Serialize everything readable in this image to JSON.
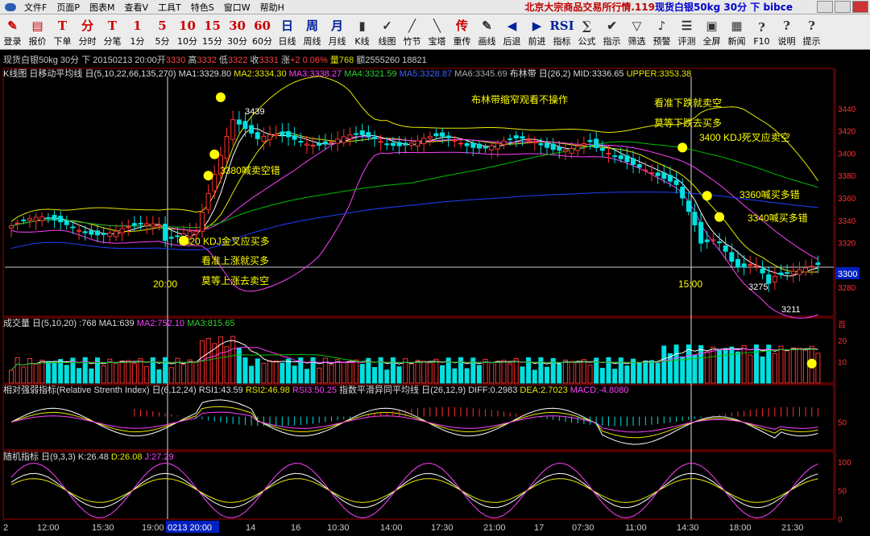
{
  "menubar": {
    "items": [
      "文件F",
      "页面P",
      "图表M",
      "查看V",
      "工具T",
      "特色S",
      "窗口W",
      "帮助H"
    ],
    "title_part1": "北京大宗商品交易所行情.119",
    "title_part2": "现货白银50kg 30分 下 bibce"
  },
  "toolbar": {
    "buttons": [
      {
        "icon": "✎",
        "label": "登录"
      },
      {
        "icon": "▤",
        "label": "报价"
      },
      {
        "icon": "T",
        "label": "下单"
      },
      {
        "icon": "分",
        "label": "分时"
      },
      {
        "icon": "T",
        "label": "分笔"
      },
      {
        "icon": "1",
        "label": "1分"
      },
      {
        "icon": "5",
        "label": "5分"
      },
      {
        "icon": "10",
        "label": "10分"
      },
      {
        "icon": "15",
        "label": "15分"
      },
      {
        "icon": "30",
        "label": "30分"
      },
      {
        "icon": "60",
        "label": "60分"
      },
      {
        "icon": "日",
        "label": "日线"
      },
      {
        "icon": "周",
        "label": "周线"
      },
      {
        "icon": "月",
        "label": "月线"
      },
      {
        "icon": "▮",
        "label": "K线"
      },
      {
        "icon": "✓",
        "label": "线图"
      },
      {
        "icon": "╱",
        "label": "竹节"
      },
      {
        "icon": "╲",
        "label": "宝塔"
      },
      {
        "icon": "传",
        "label": "重传"
      },
      {
        "icon": "✎",
        "label": "画线"
      },
      {
        "icon": "◀",
        "label": "后退"
      },
      {
        "icon": "▶",
        "label": "前进"
      },
      {
        "icon": "RSI",
        "label": "指标"
      },
      {
        "icon": "∑",
        "label": "公式"
      },
      {
        "icon": "✔",
        "label": "指示"
      },
      {
        "icon": "▽",
        "label": "筛选"
      },
      {
        "icon": "♪",
        "label": "预警"
      },
      {
        "icon": "☰",
        "label": "评测"
      },
      {
        "icon": "▣",
        "label": "全屏"
      },
      {
        "icon": "▦",
        "label": "新闻"
      },
      {
        "icon": "?",
        "label": "F10"
      },
      {
        "icon": "?",
        "label": "说明"
      },
      {
        "icon": "?",
        "label": "提示"
      }
    ]
  },
  "infobar": {
    "symbol": "现货白银50kg 30分 下",
    "date": "20150213 20:00",
    "open_label": "开",
    "open": "3330",
    "high_label": "高",
    "high": "3332",
    "low_label": "低",
    "low": "3322",
    "close_label": "收",
    "close": "3331",
    "chg_label": "涨",
    "chg": "+2 0.06%",
    "vol": "量768",
    "amount": "额2555260 18821"
  },
  "main_head": {
    "name": "K线图 日移动平均线 日(5,10,22,66,135,270)",
    "ma1": "MA1:3329.80",
    "ma2": "MA2:3334.30",
    "ma3": "MA3:3338.27",
    "ma4": "MA4:3321.59",
    "ma5": "MA5:3328.87",
    "ma6": "MA6:3345.69",
    "boll": "布林带 日(26,2)",
    "mid": "MID:3336.65",
    "upper": "UPPER:3353.38"
  },
  "vol_head": {
    "name": "成交量 日(5,10,20)",
    "cur": ":768",
    "ma1": "MA1:639",
    "ma2": "MA2:752.10",
    "ma3": "MA3:815.65"
  },
  "rsi_head": {
    "name": "相对强弱指标(Relative Strenth Index) 日(6,12,24)",
    "rsi1": "RSI1:43.59",
    "rsi2": "RSI2:46.98",
    "rsi3": "RSI3:50.25",
    "macd_name": "指数平滑异同平均线 日(26,12,9)",
    "diff": "DIFF:0.2983",
    "dea": "DEA:2.7023",
    "macd": "MACD:-4.8080"
  },
  "kdj_head": {
    "name": "随机指标 日(9,3,3)",
    "k": "K:26.48",
    "d": "D:26.08",
    "j": "J:27.29"
  },
  "annotations": {
    "a3439": "3439",
    "a3380": "3380喊卖空错",
    "a3320": "3320 KDJ金叉应买多",
    "up1": "看准上涨就买多",
    "up2": "莫等上涨去卖空",
    "boll_note": "布林带缩窄观看不操作",
    "dn1": "看准下跌就卖空",
    "dn2": "莫等下跌去买多",
    "a3400": "3400 KDJ死叉应卖空",
    "a3360": "3360喊买多错",
    "a3340": "3340喊买多错",
    "a3275": "3275",
    "a3211": "3211",
    "t2000": "20:00",
    "t1500": "15:00",
    "cur_price": "3300",
    "vol_tag": "百"
  },
  "price_axis": [
    "3440",
    "3420",
    "3400",
    "3380",
    "3360",
    "3340",
    "3320",
    "3280"
  ],
  "vol_axis": [
    "20",
    "10"
  ],
  "rsi_axis": [
    "50"
  ],
  "kdj_axis": [
    "100",
    "50",
    "0"
  ],
  "time_axis": [
    "2",
    "12:00",
    "15:30",
    "19:00",
    "0213 20:00",
    "14",
    "16",
    "10:30",
    "14:00",
    "17:30",
    "21:00",
    "17",
    "07:30",
    "11:00",
    "14:30",
    "18:00",
    "21:30"
  ],
  "colors": {
    "up": "#ff3030",
    "down": "#00e0e0",
    "ma1": "#ffffff",
    "ma2": "#e8e800",
    "ma3": "#ff40ff",
    "ma4": "#00c000",
    "ma5": "#2040ff",
    "mark": "#ffff00"
  }
}
